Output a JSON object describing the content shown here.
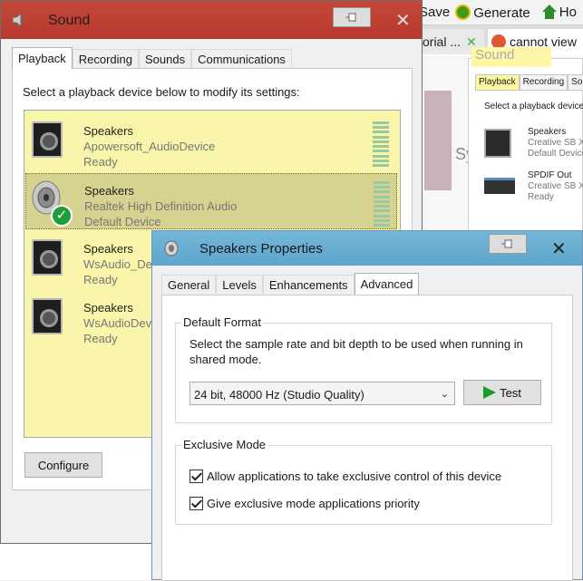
{
  "background": {
    "toolbar": {
      "save": "Save",
      "generate": "Generate",
      "home": "Ho"
    },
    "tabs": [
      {
        "label": "orial ...",
        "close": "✕"
      },
      {
        "label": "cannot view"
      }
    ],
    "highlight": "Sound",
    "mini_tabs": [
      "Playback",
      "Recording",
      "Soun"
    ],
    "mini_text": "Select a playback device",
    "mini_devices": [
      {
        "name": "Speakers",
        "sub": "Creative SB X-",
        "status": "Default Device"
      },
      {
        "name": "SPDIF Out",
        "sub": "Creative SB X-",
        "status": "Ready"
      }
    ],
    "sy": "Sy"
  },
  "sound": {
    "title": "Sound",
    "close": "✕",
    "tabs": [
      "Playback",
      "Recording",
      "Sounds",
      "Communications"
    ],
    "instruction": "Select a playback device below to modify its settings:",
    "devices": [
      {
        "name": "Speakers",
        "sub": "Apowersoft_AudioDevice",
        "status": "Ready"
      },
      {
        "name": "Speakers",
        "sub": "Realtek High Definition Audio",
        "status": "Default Device"
      },
      {
        "name": "Speakers",
        "sub": "WsAudio_Dev",
        "status": "Ready"
      },
      {
        "name": "Speakers",
        "sub": "WsAudioDevi",
        "status": "Ready"
      }
    ],
    "configure": "Configure"
  },
  "props": {
    "title": "Speakers Properties",
    "close": "✕",
    "tabs": [
      "General",
      "Levels",
      "Enhancements",
      "Advanced"
    ],
    "default_format": {
      "label": "Default Format",
      "desc_line1": "Select the sample rate and bit depth to be used when running in",
      "desc_line2": "shared mode.",
      "selected": "24 bit, 48000 Hz (Studio Quality)",
      "test": "Test"
    },
    "exclusive": {
      "label": "Exclusive Mode",
      "allow": "Allow applications to take exclusive control of this device",
      "priority": "Give exclusive mode applications priority"
    }
  },
  "colors": {
    "sound_title": "#bf3b2e",
    "props_title": "#6aafd3",
    "device_list": "#f9f6ac",
    "check_green": "#1f9d3b"
  }
}
